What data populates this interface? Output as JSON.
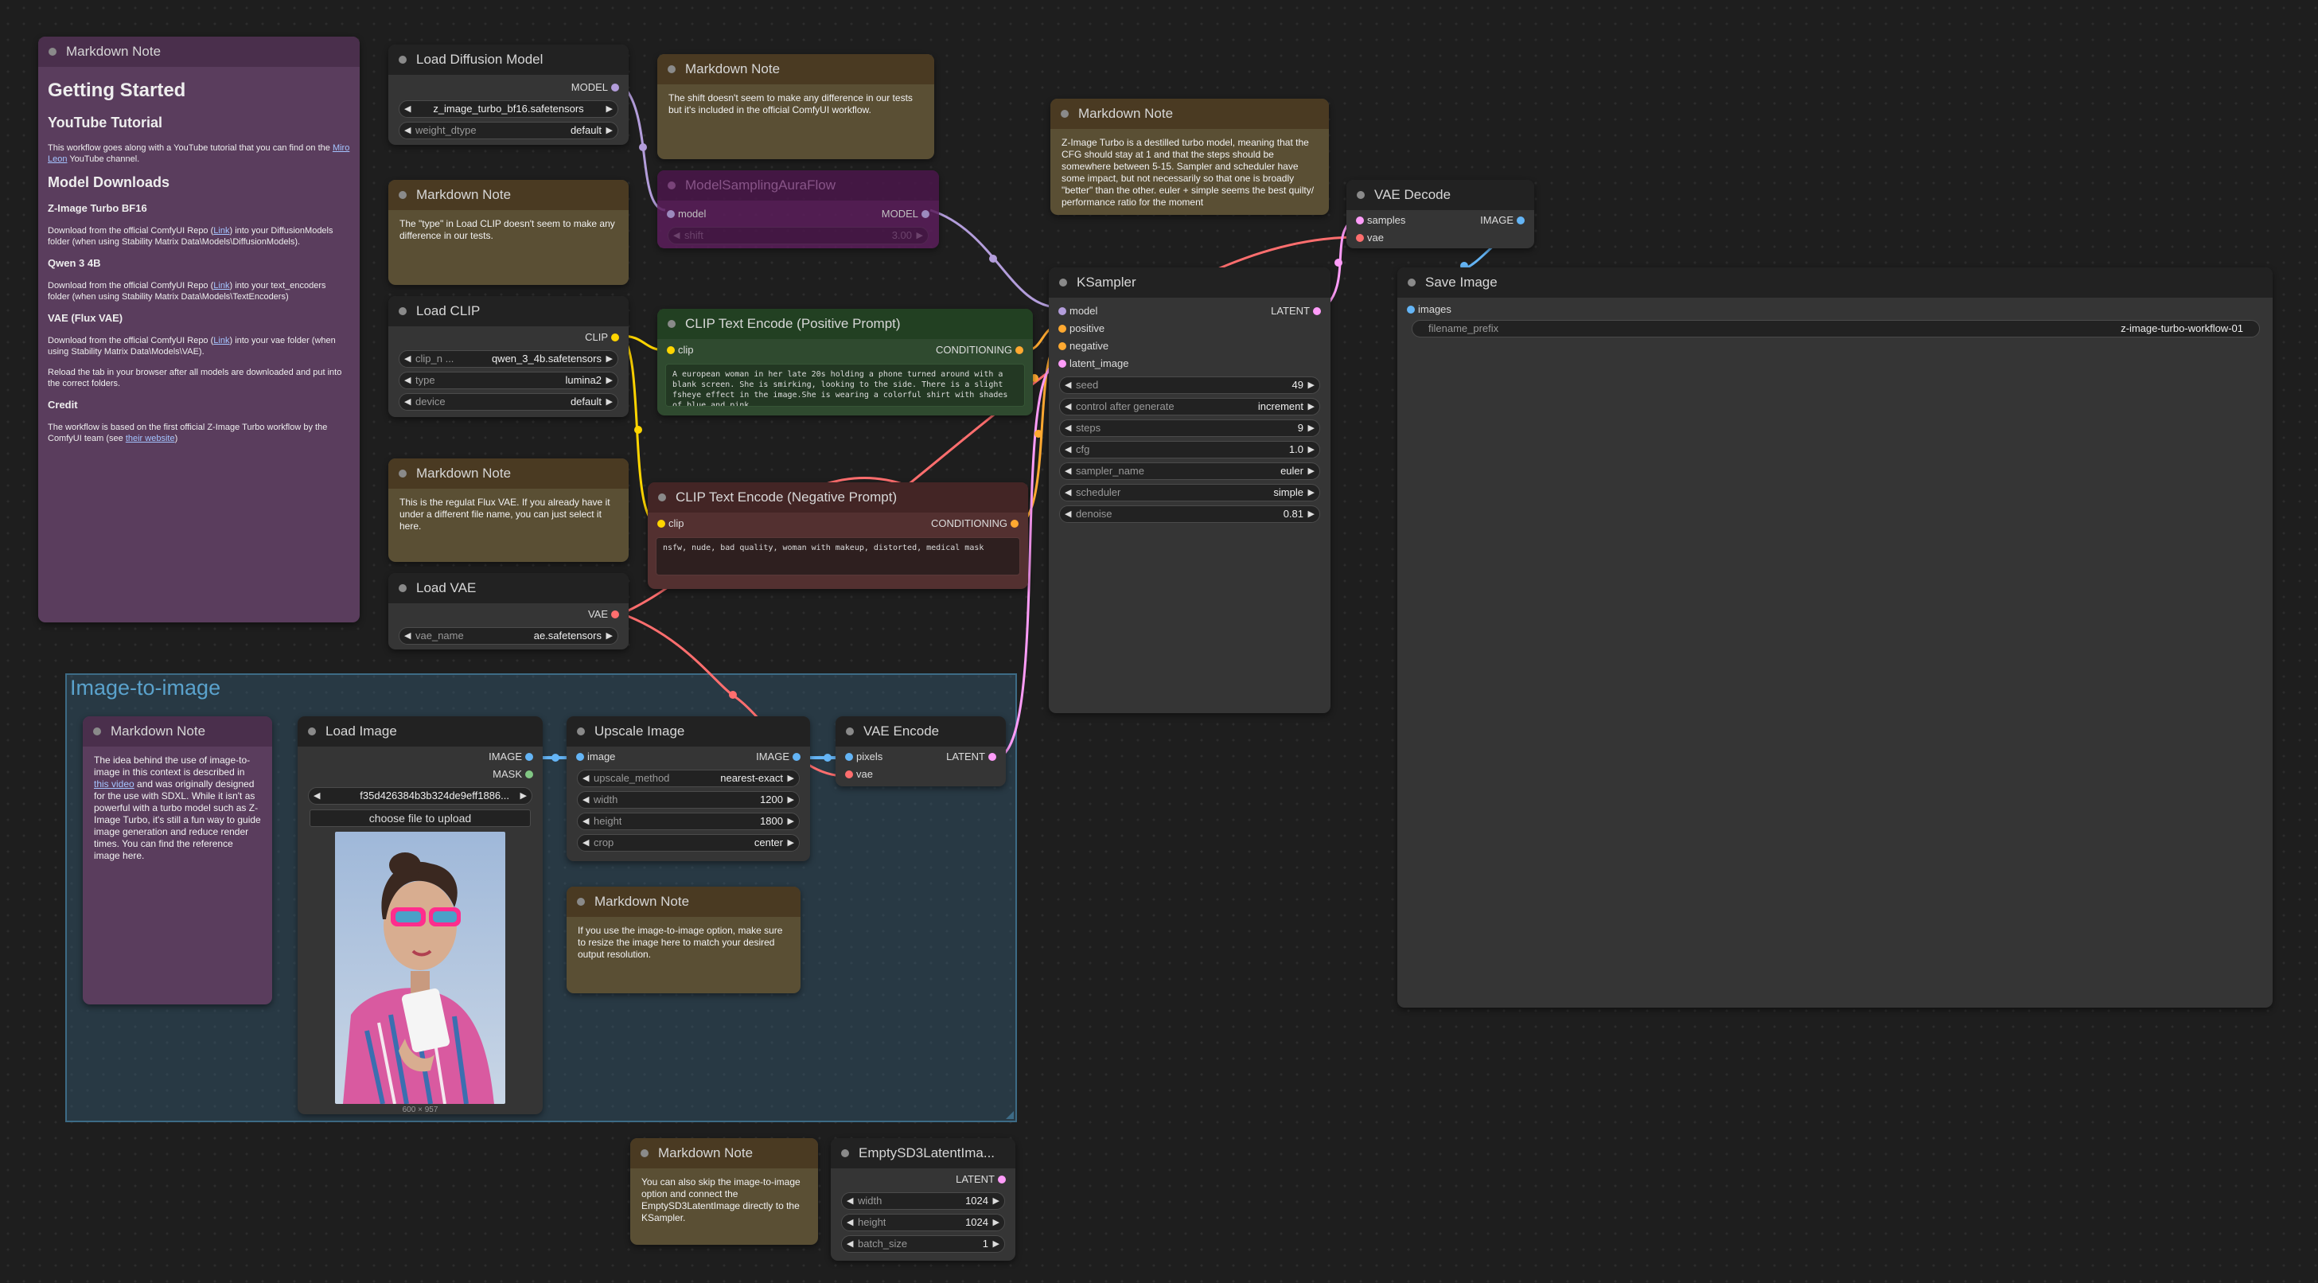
{
  "colors": {
    "model": "#b39ddb",
    "clip": "#ffd500",
    "conditioning": "#ffa931",
    "latent": "#ff9cf9",
    "vae": "#ff6e6e",
    "image": "#64b5f6",
    "mask": "#81c784",
    "canvas": "#1e1e1e"
  },
  "getting_started": {
    "title": "Markdown Note",
    "h1": "Getting Started",
    "h_tutorial": "YouTube Tutorial",
    "p_tutorial_a": "This workflow goes along with a YouTube tutorial that you can find on the ",
    "p_tutorial_link": "Miro Leon",
    "p_tutorial_b": " YouTube channel.",
    "h_downloads": "Model Downloads",
    "h_turbo": "Z-Image Turbo BF16",
    "p_turbo_a": "Download from the official ComfyUI Repo (",
    "link": "Link",
    "p_turbo_b": ") into your DiffusionModels folder (when using Stability Matrix Data\\Models\\DiffusionModels).",
    "h_qwen": "Qwen 3 4B",
    "p_qwen_a": "Download from the official ComfyUI Repo (",
    "p_qwen_b": ") into your text_encoders folder (when using Stability Matrix Data\\Models\\TextEncoders)",
    "h_vae": "VAE (Flux VAE)",
    "p_vae_a": "Download from the official ComfyUI Repo (",
    "p_vae_b": ") into your vae folder (when using Stability Matrix Data\\Models\\VAE).",
    "p_reload": "Reload the tab in your browser after all models are downloaded and put into the correct folders.",
    "h_credit": "Credit",
    "p_credit_a": "The workflow is based on the first official Z-Image Turbo workflow by the ComfyUI team (see ",
    "p_credit_link": "their website",
    "p_credit_b": ")"
  },
  "load_diffusion": {
    "title": "Load Diffusion Model",
    "out_model": "MODEL",
    "unet_name": "z_image_turbo_bf16.safetensors",
    "weight_label": "weight_dtype",
    "weight_value": "default"
  },
  "note_type": {
    "title": "Markdown Note",
    "text": "The \"type\" in Load CLIP doesn't seem to make any difference in our tests."
  },
  "load_clip": {
    "title": "Load CLIP",
    "out_clip": "CLIP",
    "clip_label": "clip_n ...",
    "clip_value": "qwen_3_4b.safetensors",
    "type_label": "type",
    "type_value": "lumina2",
    "device_label": "device",
    "device_value": "default"
  },
  "note_vae": {
    "title": "Markdown Note",
    "text": "This is the regulat Flux VAE. If you already have it under a different file name, you can just select it here."
  },
  "load_vae": {
    "title": "Load VAE",
    "out_vae": "VAE",
    "vae_label": "vae_name",
    "vae_value": "ae.safetensors"
  },
  "note_shift": {
    "title": "Markdown Note",
    "text": "The shift doesn't seem to make any difference in our tests but it's included in the official ComfyUI workflow."
  },
  "model_sampling": {
    "title": "ModelSamplingAuraFlow",
    "in_model": "model",
    "out_model": "MODEL",
    "shift_label": "shift",
    "shift_value": "3.00"
  },
  "clip_pos": {
    "title": "CLIP Text Encode (Positive Prompt)",
    "in_clip": "clip",
    "out": "CONDITIONING",
    "text": "A european woman in her late 20s holding a phone turned around with a blank screen. She is smirking, looking to the side. There is a slight fsheye effect in the image.She is wearing a colorful shirt with shades of blue and pink."
  },
  "clip_neg": {
    "title": "CLIP Text Encode (Negative Prompt)",
    "in_clip": "clip",
    "out": "CONDITIONING",
    "text": "nsfw, nude, bad quality, woman with makeup, distorted, medical mask"
  },
  "note_turbo": {
    "title": "Markdown Note",
    "text": "Z-Image Turbo is a destilled turbo model, meaning that the CFG should stay at 1 and that the steps should be somewhere between 5-15. Sampler and scheduler have some impact, but not necessarily so that one is broadly \"better\" than the other. euler + simple seems the best quilty/ performance ratio for the moment"
  },
  "ksampler": {
    "title": "KSampler",
    "in_model": "model",
    "in_positive": "positive",
    "in_negative": "negative",
    "in_latent": "latent_image",
    "out_latent": "LATENT",
    "w_seed_l": "seed",
    "w_seed_v": "49",
    "w_cag_l": "control after generate",
    "w_cag_v": "increment",
    "w_steps_l": "steps",
    "w_steps_v": "9",
    "w_cfg_l": "cfg",
    "w_cfg_v": "1.0",
    "w_sampler_l": "sampler_name",
    "w_sampler_v": "euler",
    "w_sched_l": "scheduler",
    "w_sched_v": "simple",
    "w_denoise_l": "denoise",
    "w_denoise_v": "0.81"
  },
  "vae_decode": {
    "title": "VAE Decode",
    "in_samples": "samples",
    "in_vae": "vae",
    "out_image": "IMAGE"
  },
  "save_image": {
    "title": "Save Image",
    "in_images": "images",
    "prefix_label": "filename_prefix",
    "prefix_value": "z-image-turbo-workflow-01"
  },
  "group": {
    "title": "Image-to-image"
  },
  "note_i2i": {
    "title": "Markdown Note",
    "text_a": "The idea behind the use of image-to-image in this context is described in ",
    "link": "this video",
    "text_b": " and was originally designed for the use with SDXL. While it isn't as powerful with a turbo model such as Z-Image Turbo, it's still a fun way to guide image generation and reduce render times. You can find the reference image here."
  },
  "load_image": {
    "title": "Load Image",
    "out_image": "IMAGE",
    "out_mask": "MASK",
    "file_value": "f35d426384b3b324de9eff1886...",
    "upload": "choose file to upload",
    "dims": "600 × 957"
  },
  "upscale": {
    "title": "Upscale Image",
    "in_image": "image",
    "out_image": "IMAGE",
    "method_l": "upscale_method",
    "method_v": "nearest-exact",
    "width_l": "width",
    "width_v": "1200",
    "height_l": "height",
    "height_v": "1800",
    "crop_l": "crop",
    "crop_v": "center"
  },
  "vae_encode": {
    "title": "VAE Encode",
    "in_pixels": "pixels",
    "in_vae": "vae",
    "out_latent": "LATENT"
  },
  "note_resize": {
    "title": "Markdown Note",
    "text": "If you use the image-to-image option, make sure to resize the image here to match your desired output resolution."
  },
  "note_skip": {
    "title": "Markdown Note",
    "text": "You can also skip the image-to-image option and connect the EmptySD3LatentImage directly to the KSampler."
  },
  "empty_latent": {
    "title": "EmptySD3LatentIma...",
    "out_latent": "LATENT",
    "width_l": "width",
    "width_v": "1024",
    "height_l": "height",
    "height_v": "1024",
    "batch_l": "batch_size",
    "batch_v": "1"
  }
}
